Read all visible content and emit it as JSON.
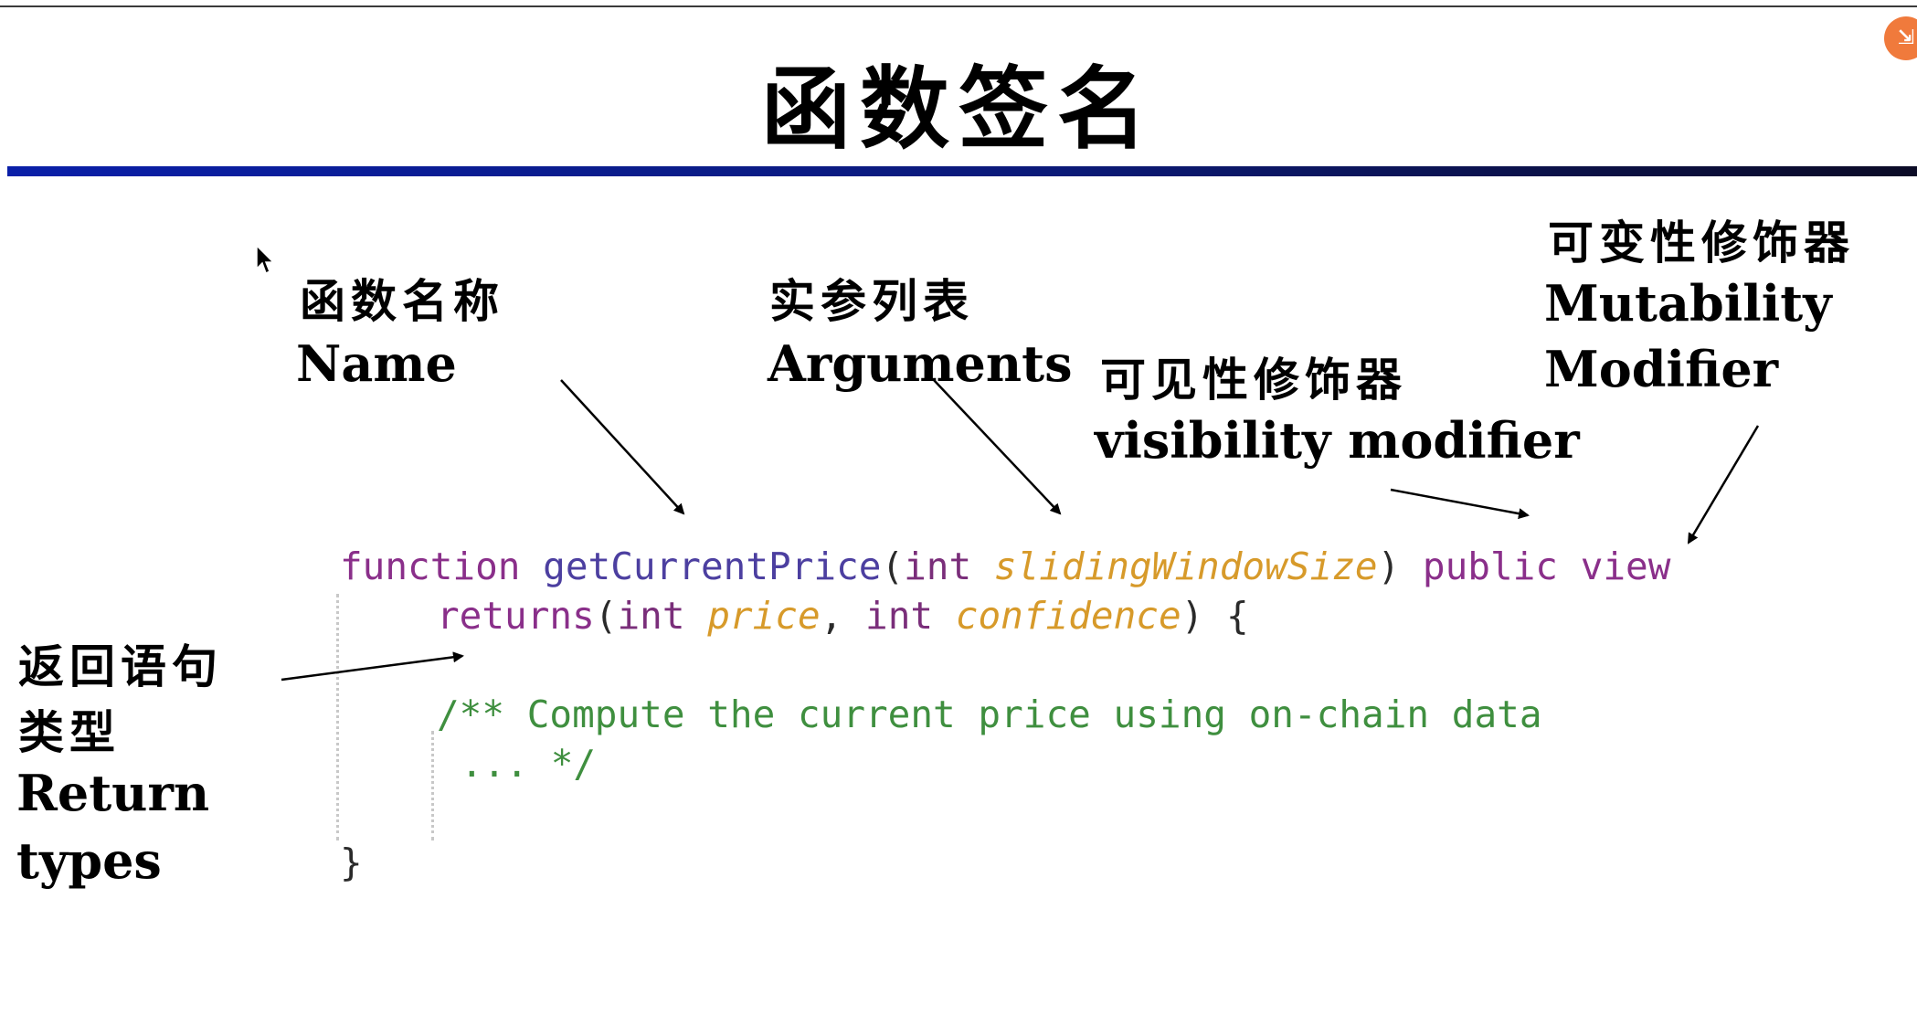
{
  "slide": {
    "title": "函数签名",
    "badge_icon": "orange-circle-icon"
  },
  "labels": {
    "name_zh": "函数名称",
    "name_en": "Name",
    "args_zh": "实参列表",
    "args_en": "Arguments",
    "vis_zh": "可见性修饰器",
    "vis_en": "visibility modifier",
    "mut_zh": "可变性修饰器",
    "mut_en1": "Mutability",
    "mut_en2": "Modifier",
    "ret_zh1": "返回语句",
    "ret_zh2": "类型",
    "ret_en1": "Return",
    "ret_en2": "types"
  },
  "code": {
    "l1_function": "function",
    "l1_name": "getCurrentPrice",
    "l1_open": "(",
    "l1_int": "int",
    "l1_param": "slidingWindowSize",
    "l1_close": ")",
    "l1_public": "public",
    "l1_view": "view",
    "l2_returns": "returns",
    "l2_open": "(",
    "l2_int1": "int",
    "l2_price": "price",
    "l2_comma": ",",
    "l2_int2": "int",
    "l2_conf": "confidence",
    "l2_close": ")",
    "l2_brace": "{",
    "l3_comment": "/** Compute the current price using on-chain data",
    "l4_comment": "... */",
    "l5_brace": "}"
  },
  "colors": {
    "keyword": "#8a2f8a",
    "function_name": "#4c3fa0",
    "parameter": "#d79a2a",
    "comment": "#3f8f3f",
    "rule": "#0a1fa8",
    "badge": "#f07a3c"
  }
}
